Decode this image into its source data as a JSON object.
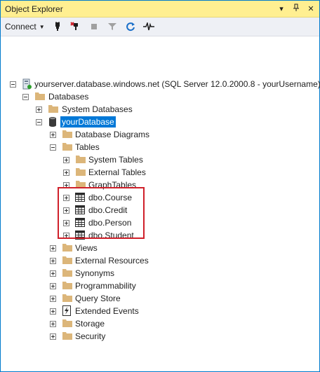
{
  "window": {
    "title": "Object Explorer",
    "controls": {
      "dropdown": "▾",
      "pin": "📌",
      "close": "✕"
    }
  },
  "toolbar": {
    "connect_label": "Connect",
    "buttons": [
      "connect-icon",
      "disconnect-icon",
      "stop-icon",
      "filter-icon",
      "refresh-icon",
      "activity-monitor-icon"
    ]
  },
  "tree": {
    "server": "yourserver.database.windows.net (SQL Server 12.0.2000.8 - yourUsername)",
    "databases": "Databases",
    "system_databases": "System Databases",
    "your_database": "yourDatabase",
    "database_diagrams": "Database Diagrams",
    "tables": "Tables",
    "system_tables": "System Tables",
    "external_tables": "External Tables",
    "graph_tables": "GraphTables",
    "table_items": [
      "dbo.Course",
      "dbo.Credit",
      "dbo.Person",
      "dbo.Student"
    ],
    "views": "Views",
    "external_resources": "External Resources",
    "synonyms": "Synonyms",
    "programmability": "Programmability",
    "query_store": "Query Store",
    "extended_events": "Extended Events",
    "storage": "Storage",
    "security": "Security"
  },
  "colors": {
    "title_bar": "#ffef91",
    "accent": "#007acc",
    "selection": "#0078d7",
    "highlight_box": "#d0202a",
    "folder": "#dcb67a"
  }
}
